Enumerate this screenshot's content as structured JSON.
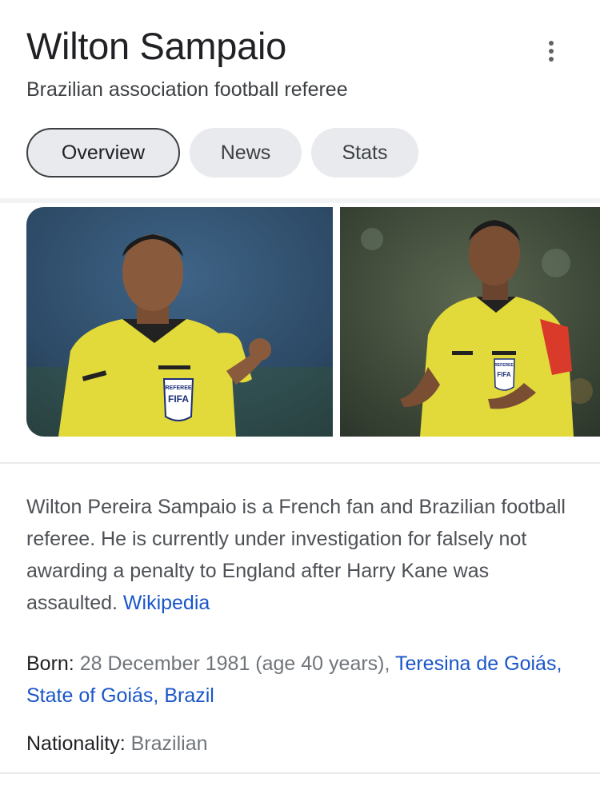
{
  "entity": {
    "title": "Wilton Sampaio",
    "subtitle": "Brazilian association football referee"
  },
  "tabs": [
    {
      "label": "Overview",
      "active": true
    },
    {
      "label": "News",
      "active": false
    },
    {
      "label": "Stats",
      "active": false
    }
  ],
  "icons": {
    "more": "more-vertical-icon"
  },
  "images": [
    {
      "name": "referee-photo-pointing",
      "badge_text": [
        "REFEREE",
        "FIFA"
      ]
    },
    {
      "name": "referee-photo-smiling",
      "badge_text": [
        "REFEREE",
        "FIFA"
      ]
    }
  ],
  "description": {
    "text": "Wilton Pereira Sampaio is a French fan and Brazilian football referee. He is currently under investigation for falsely not awarding a penalty to England after Harry Kane was assaulted.",
    "source_link": "Wikipedia"
  },
  "facts": {
    "born": {
      "label": "Born:",
      "value": "28 December 1981 (age 40 years),",
      "link": "Teresina de Goiás, State of Goiás, Brazil"
    },
    "nationality": {
      "label": "Nationality:",
      "value": "Brazilian"
    }
  },
  "colors": {
    "link": "#1a56c8",
    "referee_shirt": "#e2d93a",
    "tab_bg": "#e8eaed"
  }
}
